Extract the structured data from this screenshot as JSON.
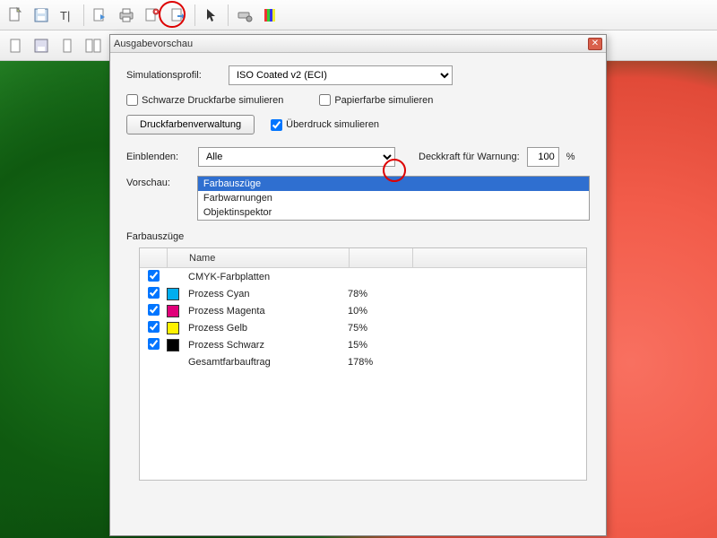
{
  "dialog": {
    "title": "Ausgabevorschau",
    "simProfileLabel": "Simulationsprofil:",
    "simProfileValue": "ISO Coated v2 (ECI)",
    "simBlackInk": "Schwarze Druckfarbe simulieren",
    "simPaper": "Papierfarbe simulieren",
    "inkManagerBtn": "Druckfarbenverwaltung",
    "simOverprint": "Überdruck simulieren",
    "showLabel": "Einblenden:",
    "showValue": "Alle",
    "opacityLabel": "Deckkraft für Warnung:",
    "opacityValue": "100",
    "opacityUnit": "%",
    "previewLabel": "Vorschau:",
    "previewItems": [
      "Farbauszüge",
      "Farbwarnungen",
      "Objektinspektor"
    ],
    "previewSelected": 0,
    "sepGroupLabel": "Farbauszüge",
    "sepHeaderName": "Name",
    "rows": [
      {
        "chk": true,
        "swatch": "",
        "name": "CMYK-Farbplatten",
        "pct": ""
      },
      {
        "chk": true,
        "swatch": "#00AEEF",
        "name": "Prozess Cyan",
        "pct": "78%"
      },
      {
        "chk": true,
        "swatch": "#E1007A",
        "name": "Prozess Magenta",
        "pct": "10%"
      },
      {
        "chk": true,
        "swatch": "#FFF200",
        "name": "Prozess Gelb",
        "pct": "75%"
      },
      {
        "chk": true,
        "swatch": "#000000",
        "name": "Prozess Schwarz",
        "pct": "15%"
      },
      {
        "chk": false,
        "swatch": "",
        "name": "Gesamtfarbauftrag",
        "pct": "178%",
        "nochk": true
      }
    ]
  }
}
